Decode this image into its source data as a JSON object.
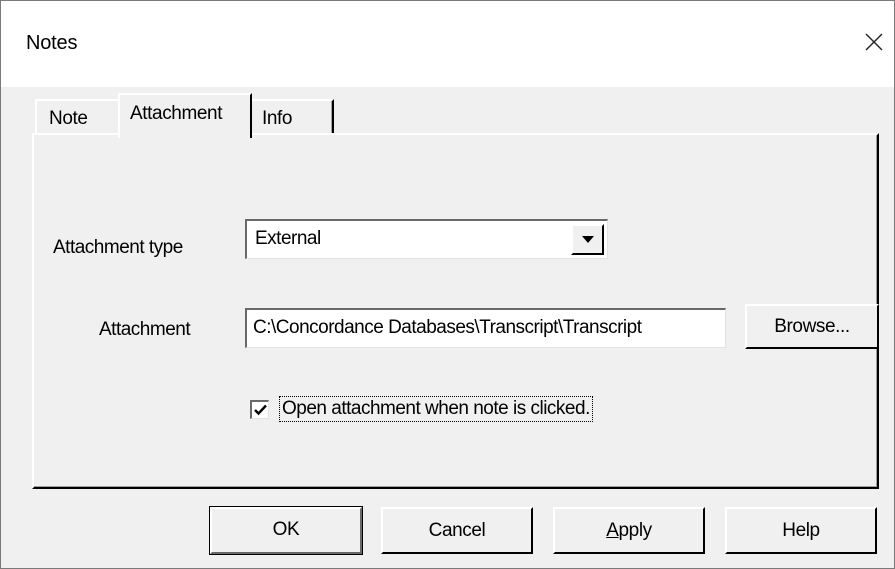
{
  "window": {
    "title": "Notes",
    "close_icon": "close-icon"
  },
  "tabs": [
    {
      "label": "Note",
      "active": false
    },
    {
      "label": "Attachment",
      "active": true
    },
    {
      "label": "Info",
      "active": false
    }
  ],
  "form": {
    "attachment_type_label": "Attachment type",
    "attachment_type_value": "External",
    "attachment_label": "Attachment",
    "attachment_value": "C:\\Concordance Databases\\Transcript\\Transcript",
    "browse_label": "Browse...",
    "open_checkbox_label": "Open attachment when note is clicked.",
    "open_checkbox_checked": true
  },
  "buttons": {
    "ok": "OK",
    "cancel": "Cancel",
    "apply_mnemonic": "A",
    "apply_rest": "pply",
    "help": "Help"
  }
}
